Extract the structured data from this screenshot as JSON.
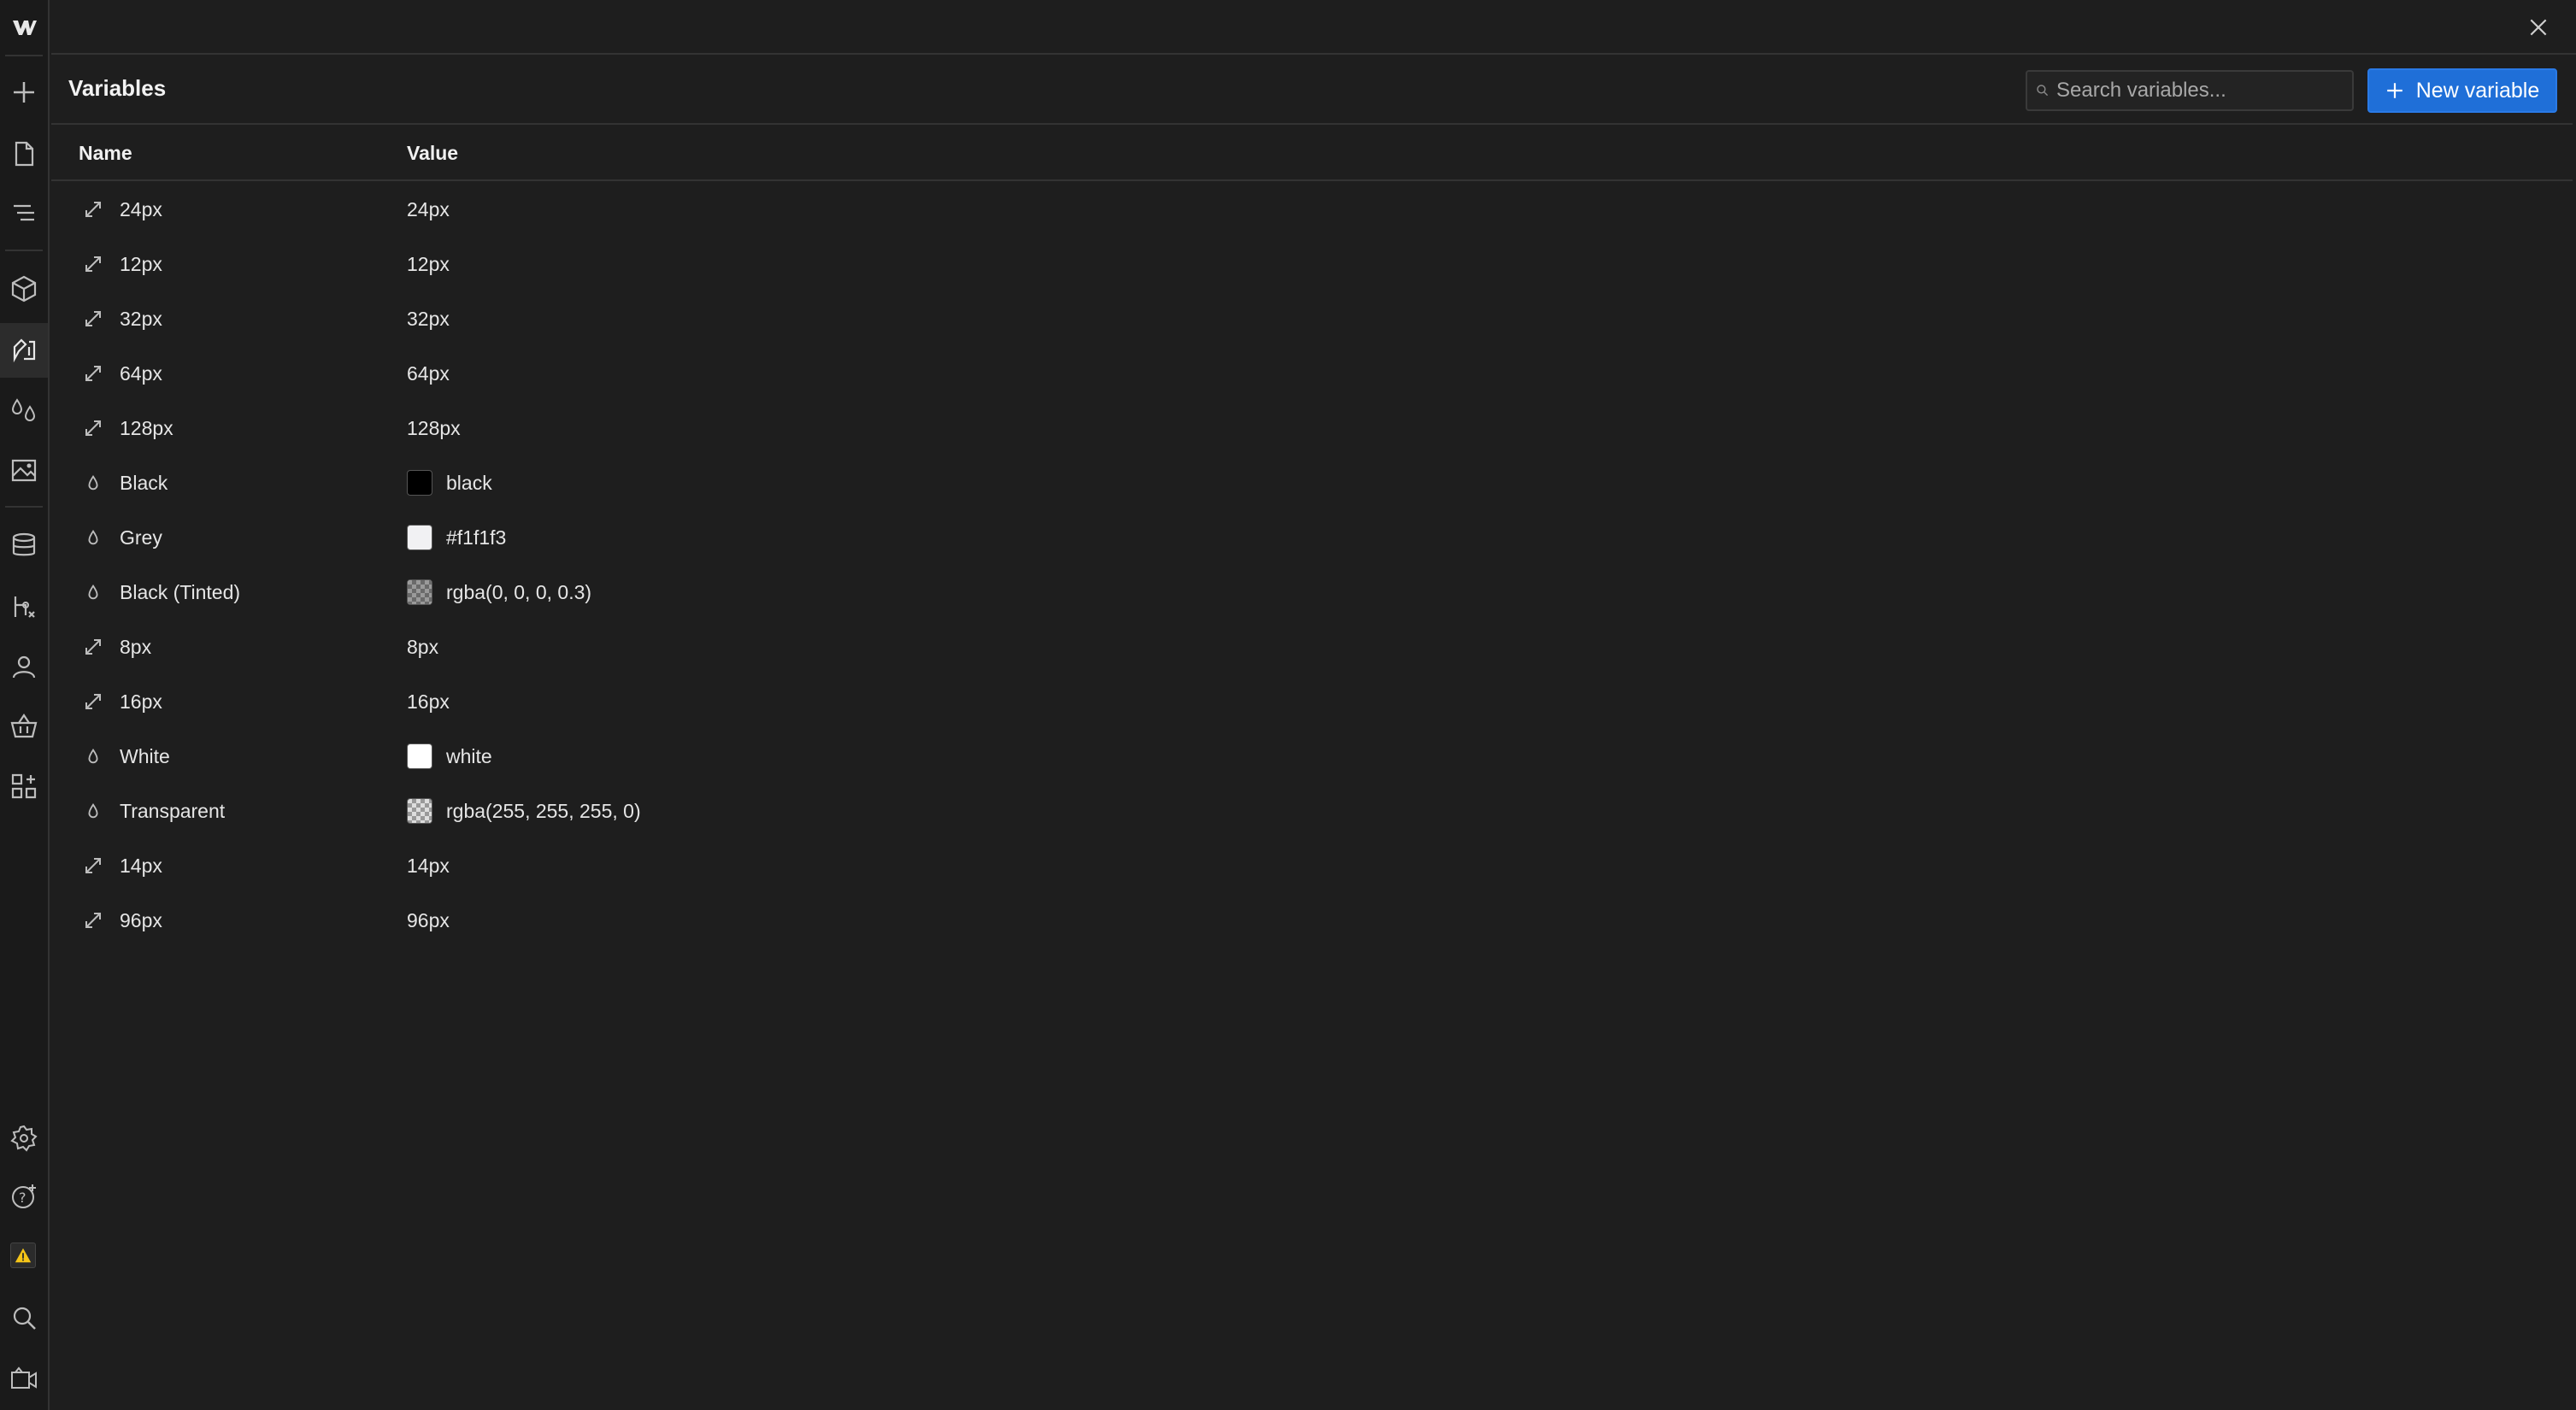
{
  "app": {
    "title": "Variables"
  },
  "search": {
    "placeholder": "Search variables..."
  },
  "toolbar": {
    "new_label": "New variable"
  },
  "table": {
    "columns": {
      "name": "Name",
      "value": "Value"
    },
    "rows": [
      {
        "name": "24px",
        "type": "size",
        "value": "24px"
      },
      {
        "name": "12px",
        "type": "size",
        "value": "12px"
      },
      {
        "name": "32px",
        "type": "size",
        "value": "32px"
      },
      {
        "name": "64px",
        "type": "size",
        "value": "64px"
      },
      {
        "name": "128px",
        "type": "size",
        "value": "128px"
      },
      {
        "name": "Black",
        "type": "color",
        "value": "black",
        "swatch": "#000000"
      },
      {
        "name": "Grey",
        "type": "color",
        "value": "#f1f1f3",
        "swatch": "#f1f1f3"
      },
      {
        "name": "Black (Tinted)",
        "type": "color",
        "value": "rgba(0, 0, 0, 0.3)",
        "swatch": "rgba(0,0,0,0.3)"
      },
      {
        "name": "8px",
        "type": "size",
        "value": "8px"
      },
      {
        "name": "16px",
        "type": "size",
        "value": "16px"
      },
      {
        "name": "White",
        "type": "color",
        "value": "white",
        "swatch": "#ffffff"
      },
      {
        "name": "Transparent",
        "type": "color",
        "value": "rgba(255, 255, 255, 0)",
        "swatch": "rgba(255,255,255,0)"
      },
      {
        "name": "14px",
        "type": "size",
        "value": "14px"
      },
      {
        "name": "96px",
        "type": "size",
        "value": "96px"
      }
    ]
  },
  "sidebar": {
    "items": [
      {
        "icon": "add-icon"
      },
      {
        "icon": "pages-icon"
      },
      {
        "icon": "navigator-icon"
      },
      {
        "icon": "components-icon"
      },
      {
        "icon": "variables-icon",
        "active": true
      },
      {
        "icon": "styles-icon"
      },
      {
        "icon": "assets-icon"
      },
      {
        "icon": "cms-icon"
      },
      {
        "icon": "logic-icon"
      },
      {
        "icon": "users-icon"
      },
      {
        "icon": "ecommerce-icon"
      },
      {
        "icon": "apps-icon"
      },
      {
        "icon": "settings-icon"
      },
      {
        "icon": "help-icon"
      },
      {
        "icon": "warning-icon"
      },
      {
        "icon": "search-icon"
      },
      {
        "icon": "video-tutorials-icon"
      }
    ]
  },
  "colors": {
    "accent": "#1f6fd8",
    "background": "#1e1e1e",
    "sidebar": "#1a1a1a",
    "warning": "#f5c518"
  }
}
